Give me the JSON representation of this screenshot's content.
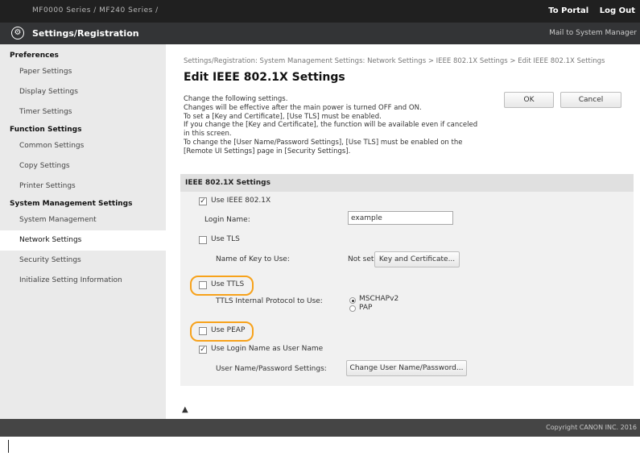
{
  "header": {
    "product": "MF0000 Series / MF240 Series /",
    "to_portal": "To Portal",
    "log_out": "Log Out"
  },
  "titlebar": {
    "title": "Settings/Registration",
    "mail": "Mail to System Manager"
  },
  "sidebar": {
    "sections": [
      {
        "label": "Preferences",
        "items": [
          "Paper Settings",
          "Display Settings",
          "Timer Settings"
        ]
      },
      {
        "label": "Function Settings",
        "items": [
          "Common Settings",
          "Copy Settings",
          "Printer Settings"
        ]
      },
      {
        "label": "System Management Settings",
        "items": [
          "System Management",
          "Network Settings",
          "Security Settings",
          "Initialize Setting Information"
        ]
      }
    ],
    "active": "Network Settings"
  },
  "main": {
    "breadcrumb": "Settings/Registration: System Management Settings: Network Settings > IEEE 802.1X Settings > Edit IEEE 802.1X Settings",
    "title": "Edit IEEE 802.1X Settings",
    "desc": [
      "Change the following settings.",
      "Changes will be effective after the main power is turned OFF and ON.",
      "To set a [Key and Certificate], [Use TLS] must be enabled.",
      "If you change the [Key and Certificate], the function will be available even if canceled",
      "in this screen.",
      "To change the [User Name/Password Settings], [Use TLS] must be enabled on the",
      "[Remote UI Settings] page in [Security Settings]."
    ],
    "ok_label": "OK",
    "cancel_label": "Cancel",
    "panel": {
      "header": "IEEE 802.1X Settings",
      "use_ieee": "Use IEEE 802.1X",
      "use_ieee_checked": true,
      "login_name_label": "Login Name:",
      "login_name_value": "example",
      "use_tls": "Use TLS",
      "use_tls_checked": false,
      "key_name_label": "Name of Key to Use:",
      "key_name_value": "Not set",
      "key_button": "Key and Certificate...",
      "use_ttls": "Use TTLS",
      "use_ttls_checked": false,
      "ttls_protocol_label": "TTLS Internal Protocol to Use:",
      "ttls_options": [
        "MSCHAPv2",
        "PAP"
      ],
      "ttls_selected": "MSCHAPv2",
      "use_peap": "Use PEAP",
      "use_peap_checked": false,
      "use_login_name": "Use Login Name as User Name",
      "use_login_name_checked": true,
      "userpass_label": "User Name/Password Settings:",
      "userpass_button": "Change User Name/Password..."
    },
    "to_top": "▲"
  },
  "footer": {
    "copyright": "Copyright CANON INC. 2016"
  },
  "colors": {
    "highlight": "#f7a21b",
    "topbar": "#202020",
    "titlebar": "#333436",
    "sidebar": "#eaeaea"
  }
}
